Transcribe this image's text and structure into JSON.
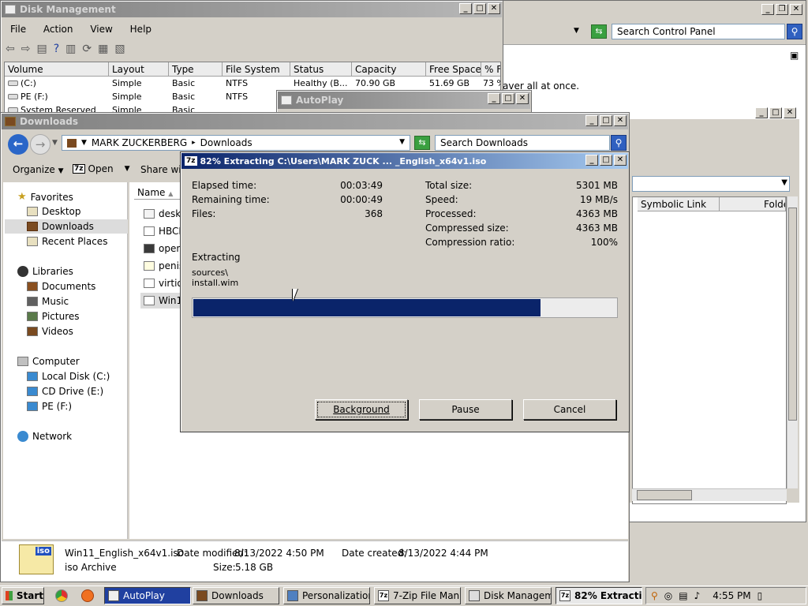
{
  "control_panel": {
    "search_placeholder": "Search Control Panel",
    "hint_text": "aver all at once.",
    "col_symbolic_link": "Symbolic Link",
    "col_folder": "Folde"
  },
  "disk_mgmt": {
    "title": "Disk Management",
    "menu": [
      "File",
      "Action",
      "View",
      "Help"
    ],
    "columns": [
      "Volume",
      "Layout",
      "Type",
      "File System",
      "Status",
      "Capacity",
      "Free Space",
      "% Fr"
    ],
    "rows": [
      [
        "(C:)",
        "Simple",
        "Basic",
        "NTFS",
        "Healthy (B...",
        "70.90 GB",
        "51.69 GB",
        "73 %"
      ],
      [
        "PE (F:)",
        "Simple",
        "Basic",
        "NTFS",
        "",
        "",
        "",
        ""
      ],
      [
        "System Reserved",
        "Simple",
        "Basic",
        "",
        "",
        "",
        "",
        ""
      ]
    ]
  },
  "autoplay": {
    "title": "AutoPlay"
  },
  "downloads": {
    "title": "Downloads",
    "breadcrumb_root": "MARK ZUCKERBERG",
    "breadcrumb_leaf": "Downloads",
    "search_placeholder": "Search Downloads",
    "toolbar": {
      "organize": "Organize",
      "open": "Open",
      "share": "Share with"
    },
    "nav": {
      "favorites": "Favorites",
      "desktop": "Desktop",
      "downloads": "Downloads",
      "recent": "Recent Places",
      "libraries": "Libraries",
      "documents": "Documents",
      "music": "Music",
      "pictures": "Pictures",
      "videos": "Videos",
      "computer": "Computer",
      "local_disk": "Local Disk (C:)",
      "cd_drive": "CD Drive (E:)",
      "pe": "PE (F:)",
      "network": "Network"
    },
    "column_name": "Name",
    "files": [
      "deskt",
      "HBCD",
      "openc",
      "penis",
      "virtio-",
      "Win1"
    ],
    "details": {
      "name": "Win11_English_x64v1.iso",
      "type": "iso Archive",
      "modified_label": "Date modified:",
      "modified": "8/13/2022 4:50 PM",
      "created_label": "Date created:",
      "created": "8/13/2022 4:44 PM",
      "size_label": "Size:",
      "size": "5.18 GB",
      "icon_text": "iso"
    }
  },
  "extract": {
    "title": "82% Extracting C:\\Users\\MARK ZUCK ... _English_x64v1.iso",
    "elapsed_label": "Elapsed time:",
    "elapsed": "00:03:49",
    "remaining_label": "Remaining time:",
    "remaining": "00:00:49",
    "files_label": "Files:",
    "files": "368",
    "total_label": "Total size:",
    "total": "5301 MB",
    "speed_label": "Speed:",
    "speed": "19 MB/s",
    "processed_label": "Processed:",
    "processed": "4363 MB",
    "compressed_label": "Compressed size:",
    "compressed": "4363 MB",
    "ratio_label": "Compression ratio:",
    "ratio": "100%",
    "status": "Extracting",
    "path1": "sources\\",
    "path2": "install.wim",
    "progress": 0.82,
    "btn_background": "Background",
    "btn_pause": "Pause",
    "btn_cancel": "Cancel"
  },
  "taskbar": {
    "start": "Start",
    "items": [
      "AutoPlay",
      "Downloads",
      "Personalization",
      "7-Zip File Man...",
      "Disk Management",
      "82% Extracti..."
    ],
    "clock": "4:55 PM"
  },
  "colors": {
    "title_active": "#0a246a",
    "progress": "#0a246a",
    "selected": "#dcdcdc"
  }
}
